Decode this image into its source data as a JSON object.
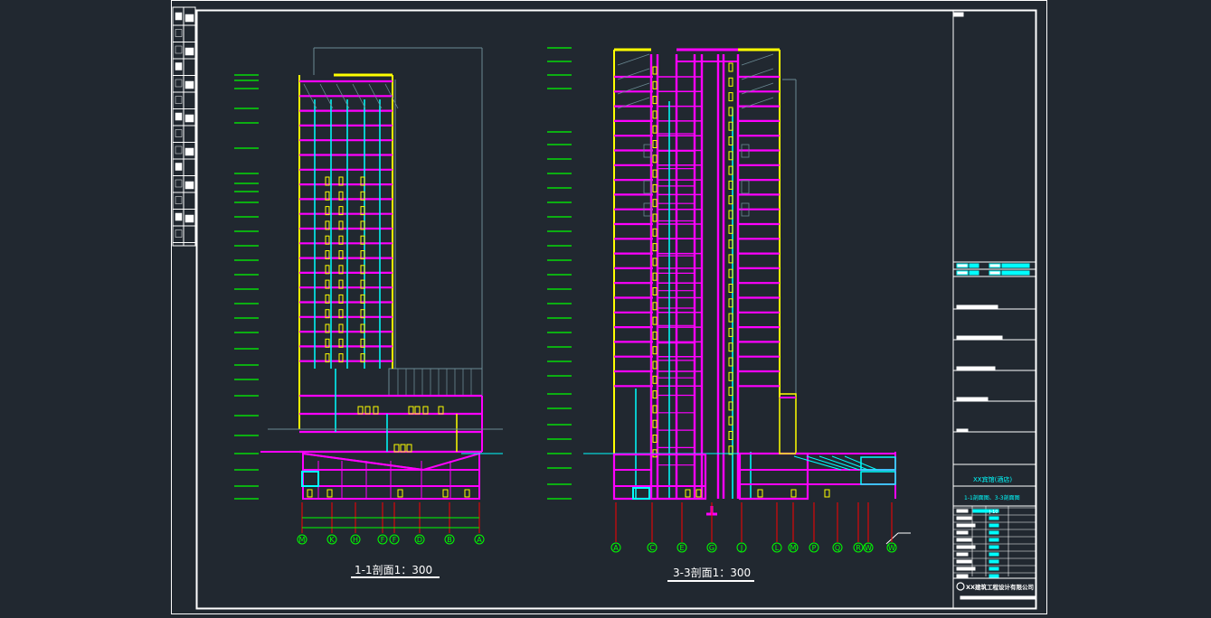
{
  "drawing": {
    "section_a": {
      "title": "1-1剖面1：300",
      "axes": [
        "M",
        "K",
        "H",
        "F",
        "F",
        "D",
        "B",
        "A"
      ]
    },
    "section_b": {
      "title": "3-3剖面1：300",
      "axes": [
        "A",
        "C",
        "E",
        "G",
        "J",
        "L",
        "M",
        "P",
        "Q",
        "R",
        "W",
        "W"
      ]
    }
  },
  "title_block": {
    "project_name": "XX宾馆(酒店)",
    "drawing_name": "1-1剖面图、3-3剖面图",
    "drawing_number": "J-10",
    "company": "XX建筑工程设计有限公司"
  },
  "colors": {
    "background": "#212830",
    "frame": "#ffffff",
    "slab": "#ff00ff",
    "wall": "#ffff00",
    "column": "#00ffff",
    "level_mark": "#00ff00",
    "axis": "#ff0000",
    "linework": "#6b8a94"
  }
}
